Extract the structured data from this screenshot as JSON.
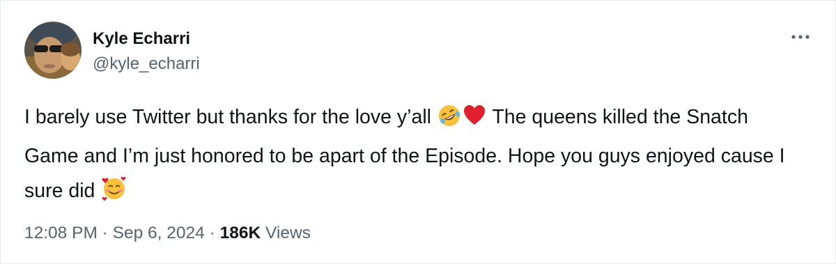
{
  "tweet": {
    "author": {
      "display_name": "Kyle Echarri",
      "handle": "@kyle_echarri"
    },
    "text": {
      "part1": "I barely use Twitter but thanks for the love y’all ",
      "part2": " The queens killed the Snatch Game and I’m just honored to be apart of the Episode. Hope you guys enjoyed cause I sure did "
    },
    "emojis": [
      "rolling-on-floor-laughing",
      "red-heart",
      "smiling-face-with-hearts"
    ],
    "meta": {
      "time": "12:08 PM",
      "separator": " · ",
      "date": "Sep 6, 2024",
      "views_count": "186K",
      "views_label": " Views"
    }
  },
  "colors": {
    "primary_text": "#0f1419",
    "secondary_text": "#536471",
    "border": "#e6ecf0"
  }
}
